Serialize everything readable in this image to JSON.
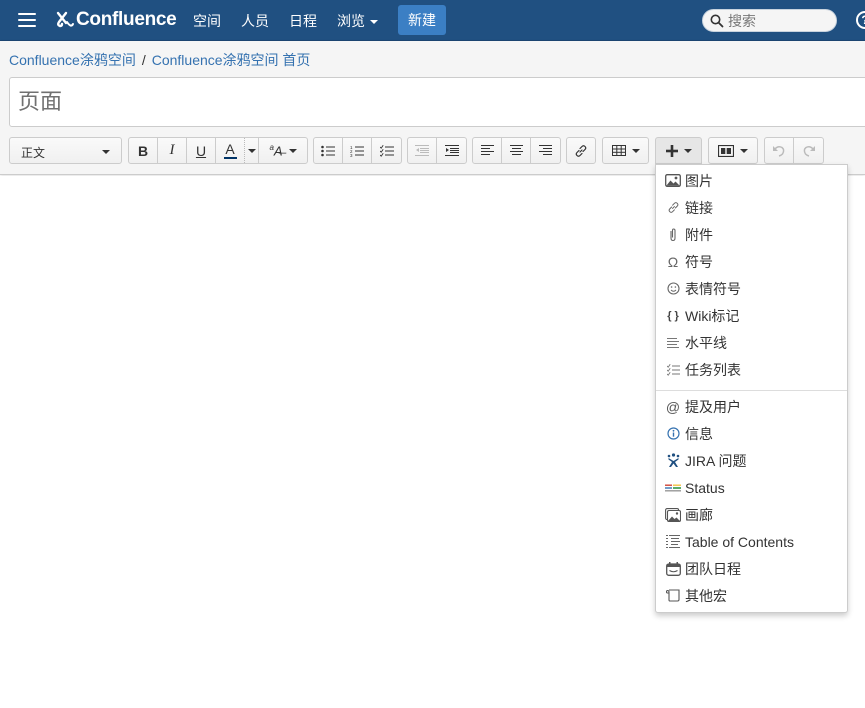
{
  "header": {
    "logo_text": "Confluence",
    "nav": [
      {
        "label": "空间"
      },
      {
        "label": "人员"
      },
      {
        "label": "日程"
      },
      {
        "label": "浏览",
        "has_caret": true
      }
    ],
    "create_label": "新建",
    "search_placeholder": "搜索",
    "help_label": "?",
    "brand_color": "#205081",
    "button_color": "#3b7fc4"
  },
  "breadcrumb": {
    "items": [
      {
        "label": "Confluence涂鸦空间"
      },
      {
        "label": "Confluence涂鸦空间 首页"
      }
    ],
    "separator": "/"
  },
  "title_field": {
    "value": "",
    "placeholder": "页面"
  },
  "toolbar": {
    "paragraph_format": "正文",
    "bold_label": "B",
    "italic_label": "I",
    "underline_label": "U",
    "text_color_label": "A",
    "text_color": "#003366",
    "more_formatting_icon": "text-style-icon",
    "list_icons": [
      "bullet-list-icon",
      "numbered-list-icon",
      "task-list-icon"
    ],
    "indent_icons": [
      "outdent-icon",
      "indent-icon"
    ],
    "align_icons": [
      "align-left-icon",
      "align-center-icon",
      "align-right-icon"
    ],
    "link_icon": "link-icon",
    "table_icon": "table-icon",
    "insert_icon": "plus-icon",
    "layout_icon": "page-layout-icon",
    "undo_icon": "undo-icon",
    "redo_icon": "redo-icon"
  },
  "insert_menu": {
    "group1": [
      {
        "label": "图片",
        "icon": "image-icon"
      },
      {
        "label": "链接",
        "icon": "link-icon"
      },
      {
        "label": "附件",
        "icon": "paperclip-icon"
      },
      {
        "label": "符号",
        "icon": "omega-icon"
      },
      {
        "label": "表情符号",
        "icon": "smiley-icon"
      },
      {
        "label": "Wiki标记",
        "icon": "braces-icon"
      },
      {
        "label": "水平线",
        "icon": "horizontal-rule-icon"
      },
      {
        "label": "任务列表",
        "icon": "task-list-icon"
      }
    ],
    "group2": [
      {
        "label": "提及用户",
        "icon": "at-icon"
      },
      {
        "label": "信息",
        "icon": "info-icon"
      },
      {
        "label": "JIRA 问题",
        "icon": "jira-icon"
      },
      {
        "label": "Status",
        "icon": "status-icon"
      },
      {
        "label": "画廊",
        "icon": "gallery-icon"
      },
      {
        "label": "Table of Contents",
        "icon": "toc-icon"
      },
      {
        "label": "团队日程",
        "icon": "calendar-icon"
      },
      {
        "label": "其他宏",
        "icon": "macro-icon"
      }
    ]
  }
}
